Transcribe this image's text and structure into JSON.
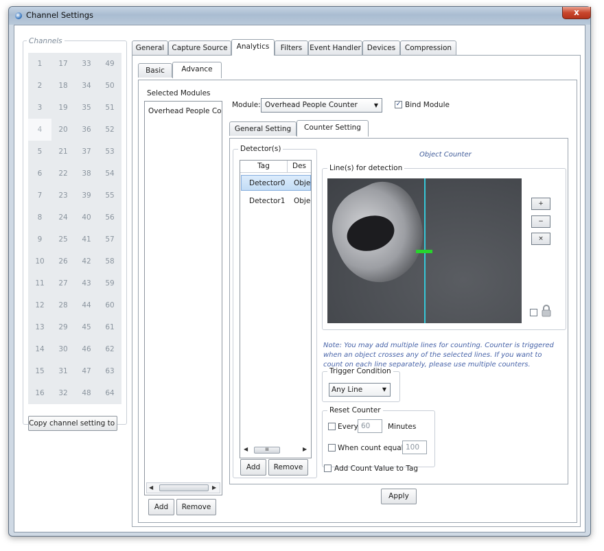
{
  "window": {
    "title": "Channel Settings",
    "close_glyph": "x"
  },
  "channels": {
    "label": "Channels",
    "grid": [
      "1",
      "17",
      "33",
      "49",
      "2",
      "18",
      "34",
      "50",
      "3",
      "19",
      "35",
      "51",
      "4",
      "20",
      "36",
      "52",
      "5",
      "21",
      "37",
      "53",
      "6",
      "22",
      "38",
      "54",
      "7",
      "23",
      "39",
      "55",
      "8",
      "24",
      "40",
      "56",
      "9",
      "25",
      "41",
      "57",
      "10",
      "26",
      "42",
      "58",
      "11",
      "27",
      "43",
      "59",
      "12",
      "28",
      "44",
      "60",
      "13",
      "29",
      "45",
      "61",
      "14",
      "30",
      "46",
      "62",
      "15",
      "31",
      "47",
      "63",
      "16",
      "32",
      "48",
      "64"
    ],
    "selected": "4",
    "copy_button": "Copy channel setting to ..."
  },
  "tabs": [
    "General",
    "Capture Source",
    "Analytics",
    "Filters",
    "Event Handler",
    "Devices",
    "Compression"
  ],
  "active_tab": "Analytics",
  "subtabs": [
    "Basic",
    "Advance"
  ],
  "active_subtab": "Advance",
  "modules": {
    "label": "Selected Modules",
    "items": [
      "Overhead People Cou"
    ],
    "add": "Add",
    "remove": "Remove"
  },
  "module_row": {
    "label": "Module:",
    "selected": "Overhead People Counter",
    "bind_label": "Bind Module",
    "bind_checked": true
  },
  "inner_tabs": [
    "General Setting",
    "Counter Setting"
  ],
  "active_inner_tab": "Counter Setting",
  "detectors": {
    "label": "Detector(s)",
    "columns": [
      "Tag",
      "Des"
    ],
    "rows": [
      {
        "tag": "Detector0",
        "desc": "Objec",
        "selected": true
      },
      {
        "tag": "Detector1",
        "desc": "Objec",
        "selected": false
      }
    ],
    "scroll_thumb": "III",
    "add": "Add",
    "remove": "Remove"
  },
  "counter": {
    "title": "Object Counter",
    "lines_label": "Line(s) for detection",
    "tool_glyphs": [
      "+",
      "−",
      "×"
    ],
    "note": "Note: You may add multiple lines for counting. Counter is triggered when an object crosses any of the selected lines. If you want to count on each line separately, please use multiple counters.",
    "trigger": {
      "label": "Trigger Condition",
      "selected": "Any Line"
    },
    "reset": {
      "label": "Reset Counter",
      "every_label": "Every",
      "every_value": "60",
      "minutes_label": "Minutes",
      "count_label": "When count equals",
      "count_value": "100"
    },
    "add_count_label": "Add Count Value to Tag"
  },
  "apply": "Apply",
  "colors": {
    "accent": "#36c8d8",
    "marker": "#27d42c",
    "note": "#4763a8"
  }
}
